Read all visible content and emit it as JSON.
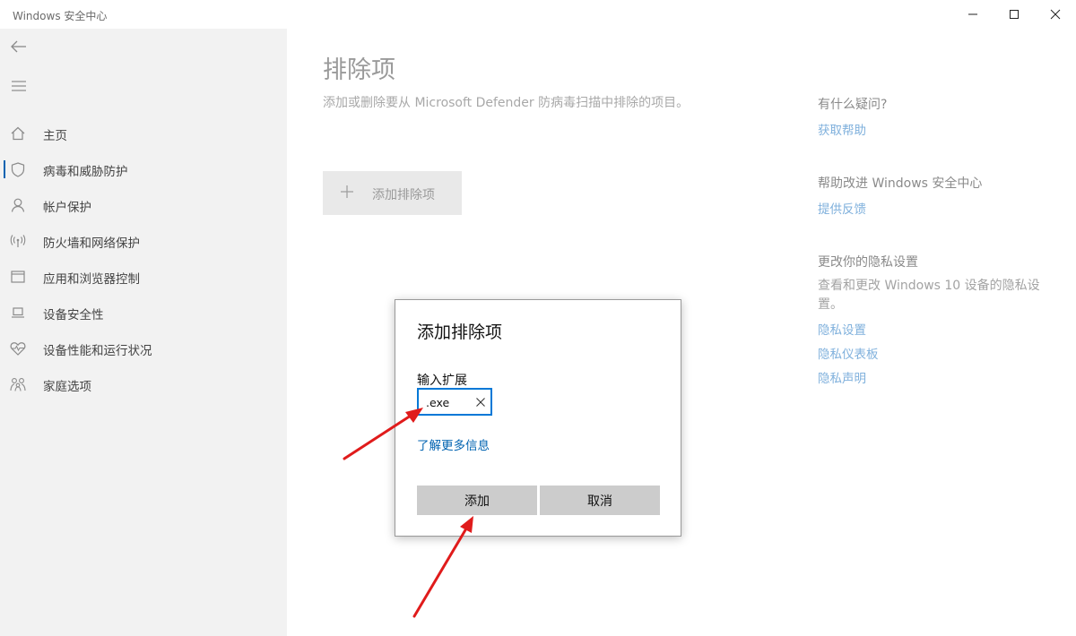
{
  "window": {
    "title": "Windows 安全中心",
    "controls": [
      "minimize",
      "maximize",
      "close"
    ]
  },
  "sidebar": {
    "back_icon": "back-arrow-icon",
    "menu_icon": "hamburger-menu-icon",
    "items": [
      {
        "label": "主页",
        "icon": "home-icon",
        "active": false
      },
      {
        "label": "病毒和威胁防护",
        "icon": "shield-icon",
        "active": true
      },
      {
        "label": "帐户保护",
        "icon": "person-icon",
        "active": false
      },
      {
        "label": "防火墙和网络保护",
        "icon": "wireless-signal-icon",
        "active": false
      },
      {
        "label": "应用和浏览器控制",
        "icon": "app-window-icon",
        "active": false
      },
      {
        "label": "设备安全性",
        "icon": "laptop-icon",
        "active": false
      },
      {
        "label": "设备性能和运行状况",
        "icon": "heart-pulse-icon",
        "active": false
      },
      {
        "label": "家庭选项",
        "icon": "family-icon",
        "active": false
      }
    ]
  },
  "main": {
    "title": "排除项",
    "description": "添加或删除要从 Microsoft Defender 防病毒扫描中排除的项目。",
    "add_button_label": "添加排除项"
  },
  "info": {
    "question_heading": "有什么疑问?",
    "get_help": "获取帮助",
    "improve_heading": "帮助改进 Windows 安全中心",
    "feedback": "提供反馈",
    "privacy_heading": "更改你的隐私设置",
    "privacy_text": "查看和更改 Windows 10 设备的隐私设置。",
    "privacy_links": [
      "隐私设置",
      "隐私仪表板",
      "隐私声明"
    ]
  },
  "dialog": {
    "title": "添加排除项",
    "input_label": "输入扩展",
    "input_value": ".exe",
    "learn_more": "了解更多信息",
    "add_label": "添加",
    "cancel_label": "取消"
  },
  "colors": {
    "accent": "#0078d7",
    "link": "#0063b1",
    "annotation_arrow": "#e01b1b"
  }
}
